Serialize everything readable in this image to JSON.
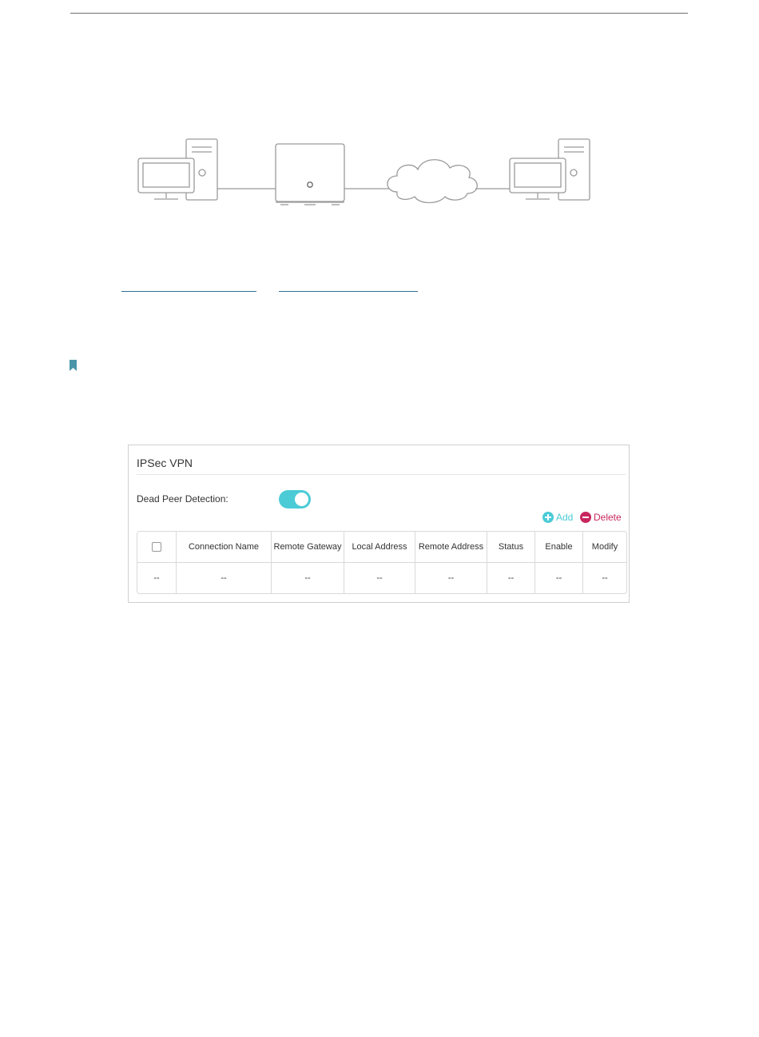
{
  "diagram": {
    "router_logo": "tp-link-logo-icon"
  },
  "panel": {
    "title": "IPSec VPN",
    "dpd_label": "Dead Peer Detection:",
    "dpd_enabled": true,
    "add_label": "Add",
    "delete_label": "Delete"
  },
  "table": {
    "columns": [
      "",
      "Connection Name",
      "Remote Gateway",
      "Local Address",
      "Remote Address",
      "Status",
      "Enable",
      "Modify"
    ],
    "rows": [
      [
        "--",
        "--",
        "--",
        "--",
        "--",
        "--",
        "--",
        "--"
      ]
    ]
  },
  "colors": {
    "accent": "#4acbd6",
    "delete": "#c8265f",
    "link": "#2f6f95",
    "note": "#4a96a8"
  }
}
